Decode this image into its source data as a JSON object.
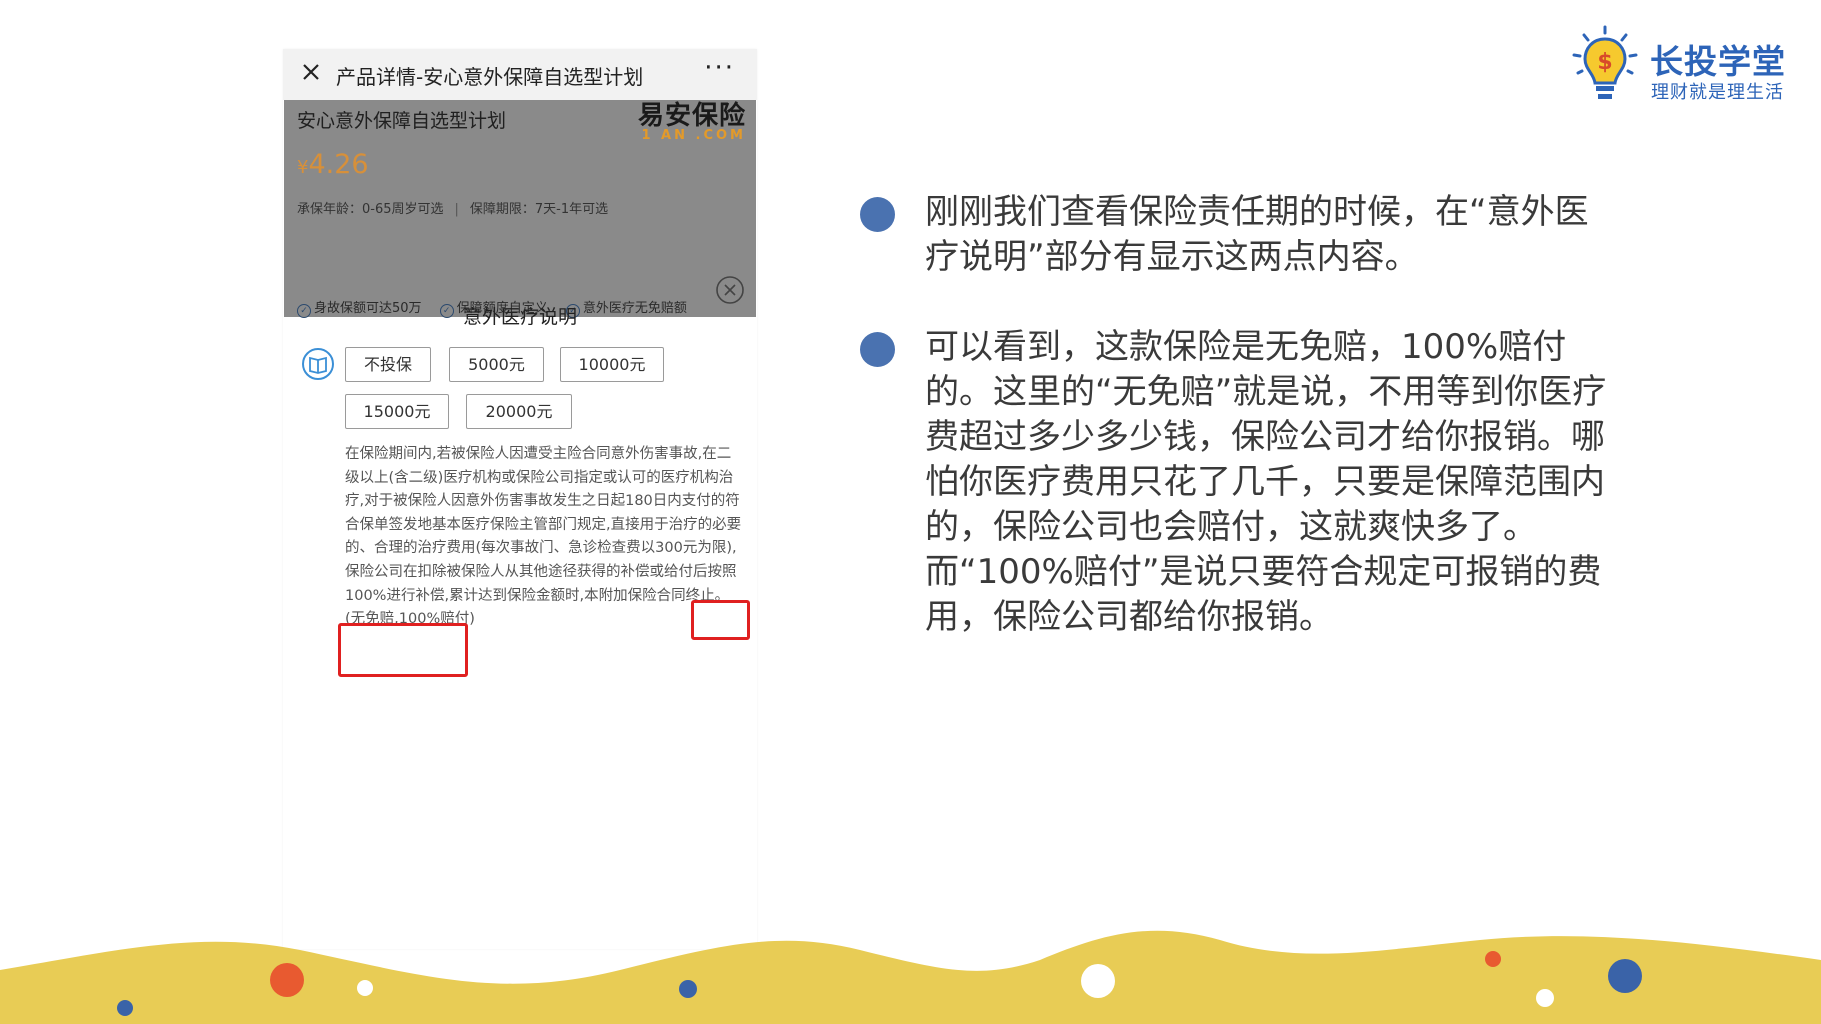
{
  "phone": {
    "nav_title": "产品详情-安心意外保障自选型计划",
    "more_label": "···",
    "product_name": "安心意外保障自选型计划",
    "logo_cn": "易安保险",
    "logo_en": "1 AN .COM",
    "currency": "¥",
    "price": "4.26",
    "age_info": "承保年龄：0-65周岁可选",
    "sep": "|",
    "period_info": "保障期限：7天-1年可选",
    "tags": [
      "身故保额可达50万",
      "保障额度自定义",
      "意外医疗无免赔额"
    ],
    "section_title": "意外医疗说明",
    "options": [
      "不投保",
      "5000元",
      "10000元",
      "15000元",
      "20000元"
    ],
    "description": "在保险期间内,若被保险人因遭受主险合同意外伤害事故,在二级以上(含二级)医疗机构或保险公司指定或认可的医疗机构治疗,对于被保险人因意外伤害事故发生之日起180日内支付的符合保单签发地基本医疗保险主管部门规定,直接用于治疗的必要的、合理的治疗费用(每次事故门、急诊检查费以300元为限),保险公司在扣除被保险人从其他途径获得的补偿或给付后按照100%进行补偿,累计达到保险金额时,本附加保险合同终止。(无免赔,100%赔付)"
  },
  "bullets": [
    "刚刚我们查看保险责任期的时候，在“意外医疗说明”部分有显示这两点内容。",
    "可以看到，这款保险是无免赔，100%赔付的。这里的“无免赔”就是说，不用等到你医疗费超过多少多少钱，保险公司才给你报销。哪怕你医疗费用只花了几千，只要是保障范围内的，保险公司也会赔付，这就爽快多了。而“100%赔付”是说只要符合规定可报销的费用，保险公司都给你报销。"
  ],
  "brand": {
    "name": "长投学堂",
    "slogan": "理财就是理生活"
  },
  "colors": {
    "bullet_dot": "#4a72b0",
    "highlight_box": "#e02020",
    "price": "#d7903a",
    "brand_blue": "#2d64b8",
    "wave_yellow": "#e8cc55"
  },
  "icons": [
    "close-icon",
    "more-icon",
    "check-circle-icon",
    "close-circle-icon",
    "book-icon",
    "lightbulb-icon"
  ]
}
